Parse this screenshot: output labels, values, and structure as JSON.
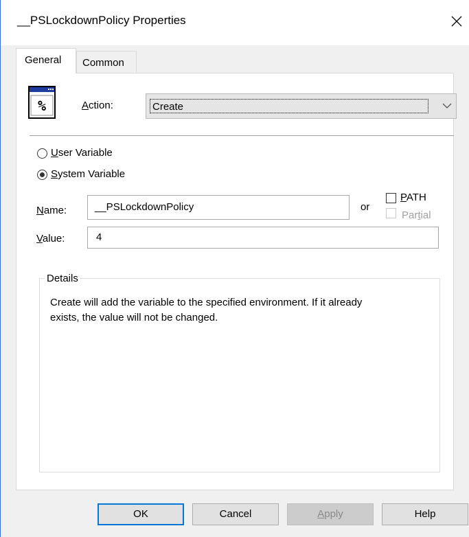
{
  "window": {
    "title": "__PSLockdownPolicy Properties"
  },
  "tabs": [
    {
      "label": "General",
      "active": true
    },
    {
      "label": "Common",
      "active": false
    }
  ],
  "icon": {
    "name": "environment-variable-icon",
    "glyph": "%"
  },
  "action": {
    "label": "Action:",
    "selected": "Create"
  },
  "scope": {
    "user_label": "User Variable",
    "system_label": "System Variable",
    "selected": "system"
  },
  "name": {
    "label": "Name:",
    "value": "__PSLockdownPolicy",
    "or_label": "or"
  },
  "path": {
    "label": "PATH",
    "checked": false
  },
  "partial": {
    "label": "Partial",
    "enabled": false
  },
  "value": {
    "label": "Value:",
    "value": "4"
  },
  "details": {
    "legend": "Details",
    "text": "Create will add the variable to the specified environment. If it already exists, the value will not be changed."
  },
  "buttons": {
    "ok": "OK",
    "cancel": "Cancel",
    "apply": "Apply",
    "help": "Help"
  },
  "colors": {
    "accent": "#0078d7",
    "window_border": "#3a6fd8",
    "disabled_text": "#a0a0a0"
  }
}
